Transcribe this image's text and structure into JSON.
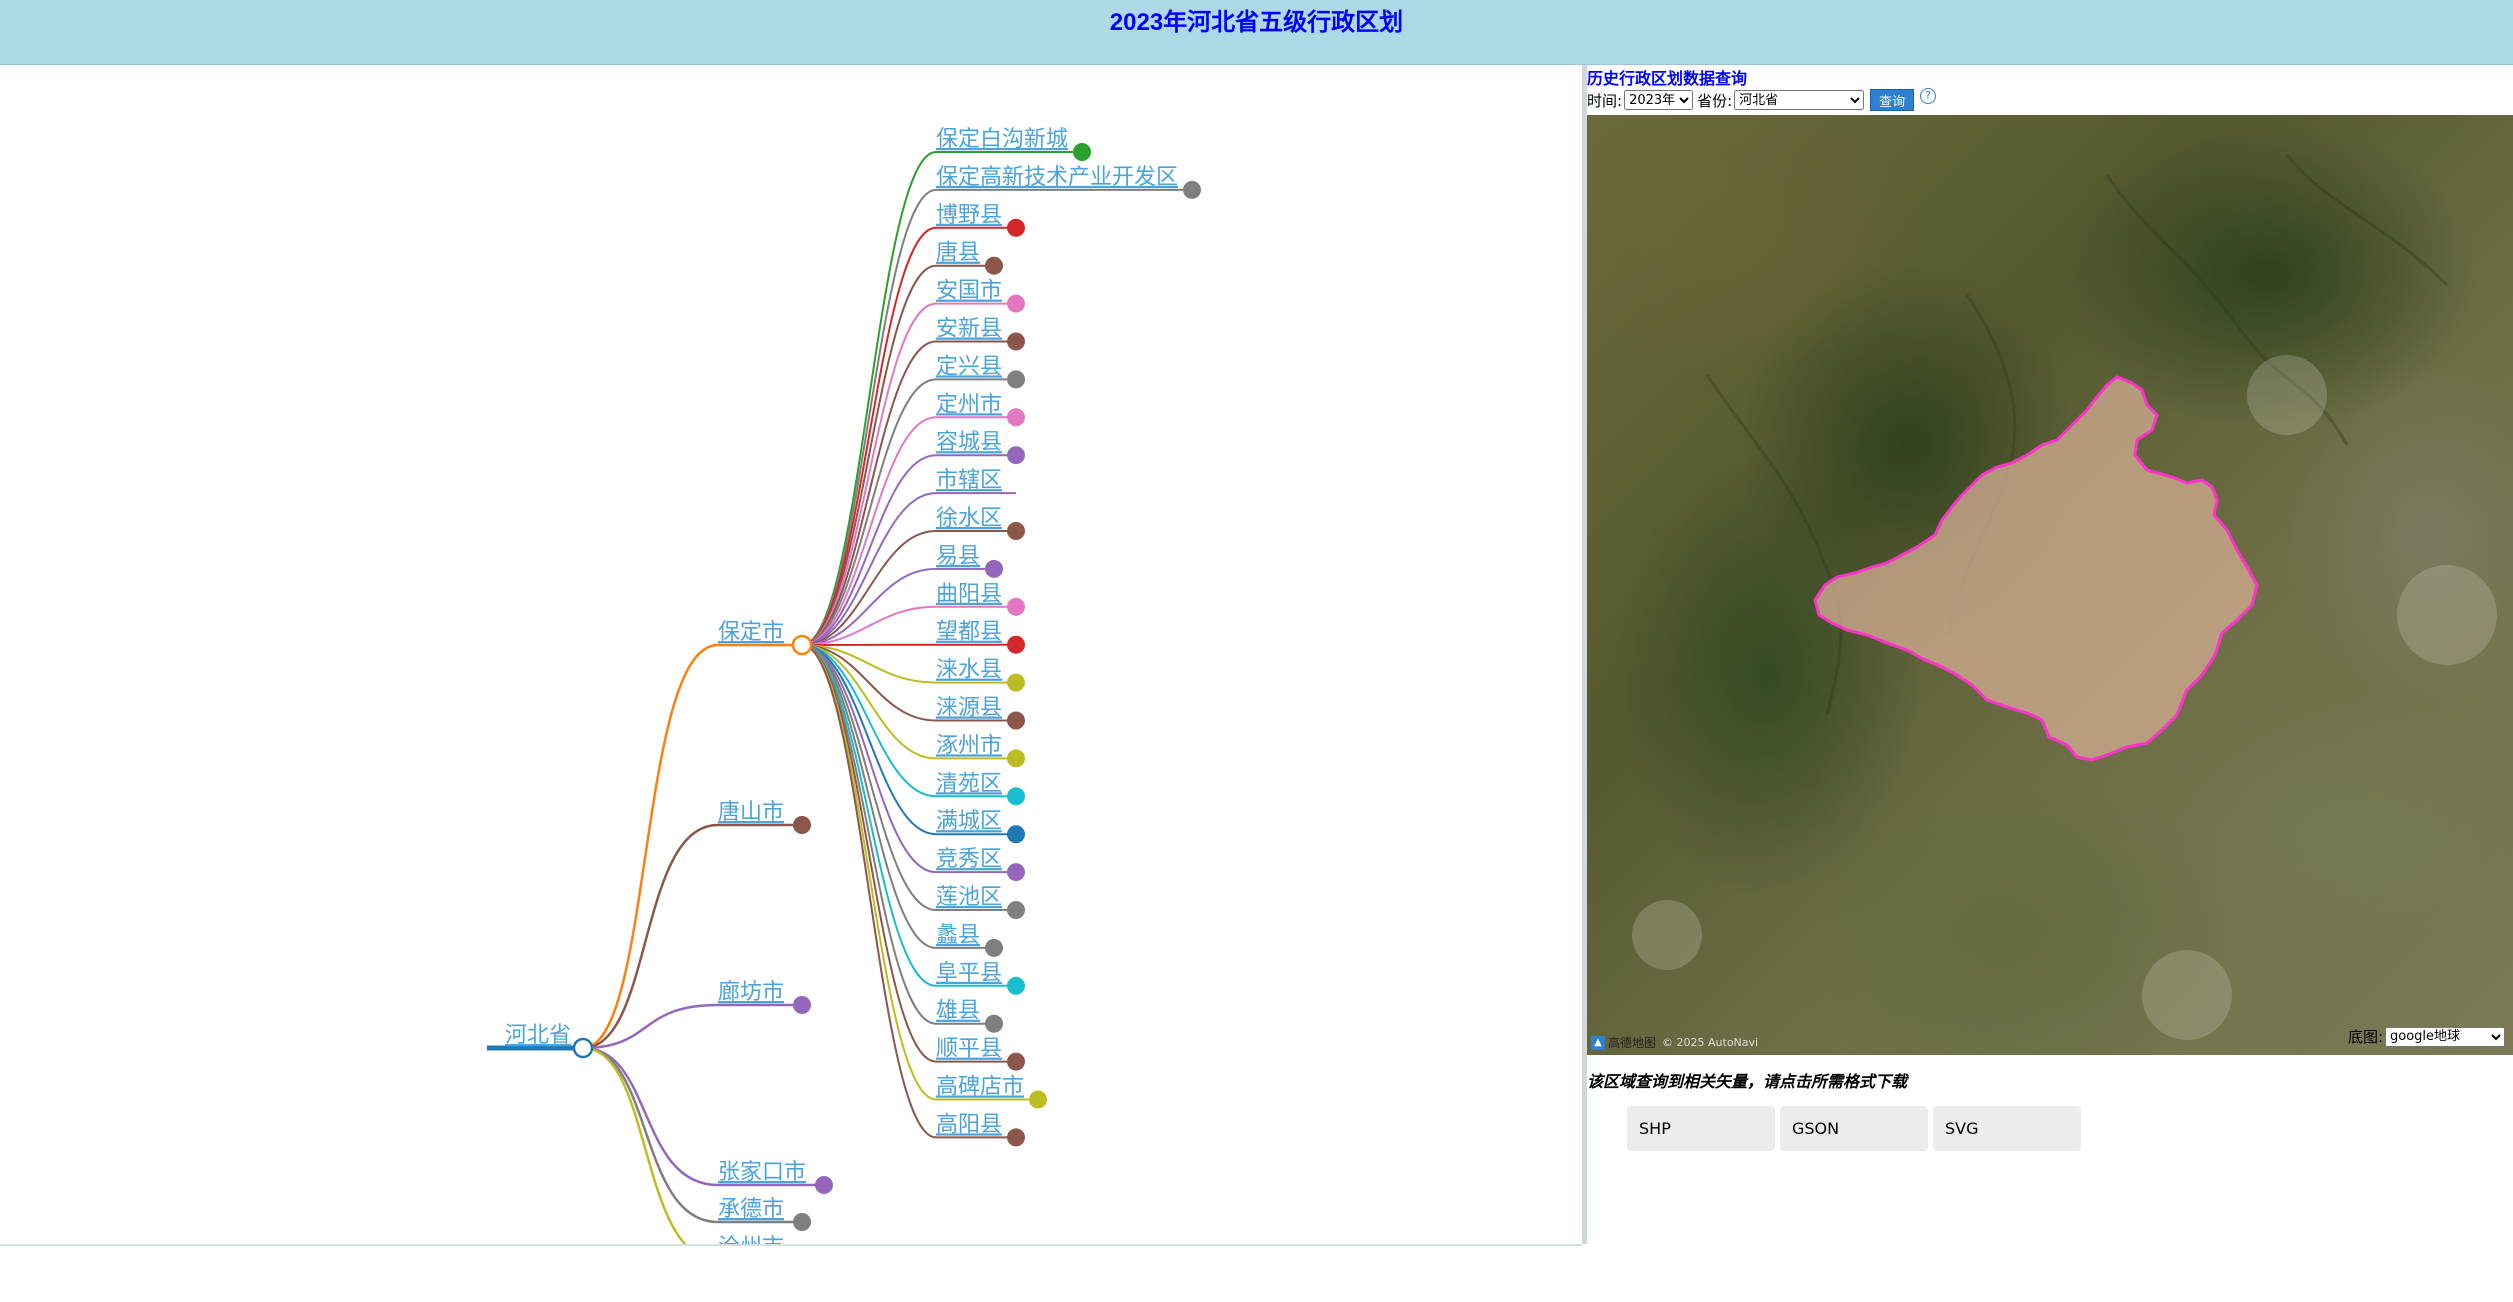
{
  "header": {
    "title": "2023年河北省五级行政区划"
  },
  "tree": {
    "root": {
      "name": "河北省",
      "color": "#1f77b4"
    },
    "cities": [
      {
        "name": "保定市",
        "color": "#ff7f0e",
        "expanded": true
      },
      {
        "name": "唐山市",
        "color": "#8c564b"
      },
      {
        "name": "廊坊市",
        "color": "#9467bd"
      },
      {
        "name": "张家口市",
        "color": "#9467bd"
      },
      {
        "name": "承德市",
        "color": "#7f7f7f"
      },
      {
        "name": "沧州市",
        "color": "#bcbd22"
      }
    ],
    "counties": [
      {
        "name": "保定白沟新城",
        "color": "#2ca02c"
      },
      {
        "name": "保定高新技术产业开发区",
        "color": "#7f7f7f"
      },
      {
        "name": "博野县",
        "color": "#d62728"
      },
      {
        "name": "唐县",
        "color": "#8c564b"
      },
      {
        "name": "安国市",
        "color": "#e377c2"
      },
      {
        "name": "安新县",
        "color": "#8c564b"
      },
      {
        "name": "定兴县",
        "color": "#7f7f7f"
      },
      {
        "name": "定州市",
        "color": "#e377c2"
      },
      {
        "name": "容城县",
        "color": "#9467bd"
      },
      {
        "name": "市辖区",
        "color": "#9467bd",
        "no_dot": true
      },
      {
        "name": "徐水区",
        "color": "#8c564b"
      },
      {
        "name": "易县",
        "color": "#9467bd"
      },
      {
        "name": "曲阳县",
        "color": "#e377c2"
      },
      {
        "name": "望都县",
        "color": "#d62728"
      },
      {
        "name": "涞水县",
        "color": "#bcbd22"
      },
      {
        "name": "涞源县",
        "color": "#8c564b"
      },
      {
        "name": "涿州市",
        "color": "#bcbd22"
      },
      {
        "name": "清苑区",
        "color": "#17becf"
      },
      {
        "name": "满城区",
        "color": "#1f77b4"
      },
      {
        "name": "竞秀区",
        "color": "#9467bd"
      },
      {
        "name": "莲池区",
        "color": "#7f7f7f"
      },
      {
        "name": "蠡县",
        "color": "#7f7f7f"
      },
      {
        "name": "阜平县",
        "color": "#17becf"
      },
      {
        "name": "雄县",
        "color": "#7f7f7f"
      },
      {
        "name": "顺平县",
        "color": "#8c564b"
      },
      {
        "name": "高碑店市",
        "color": "#bcbd22"
      },
      {
        "name": "高阳县",
        "color": "#8c564b"
      }
    ]
  },
  "query": {
    "title": "历史行政区划数据查询",
    "time_label": "时间:",
    "time_value": "2023年",
    "province_label": "省份:",
    "province_value": "河北省",
    "button": "查询",
    "help": "?"
  },
  "map": {
    "attribution": "高德地图",
    "copyright": "© 2025 AutoNavi",
    "basemap_label": "底图:",
    "basemap_value": "google地球",
    "boundary_color": "#ff33cc"
  },
  "download": {
    "note": "该区域查询到相关矢量，请点击所需格式下载",
    "buttons": [
      "SHP",
      "GSON",
      "SVG"
    ]
  }
}
